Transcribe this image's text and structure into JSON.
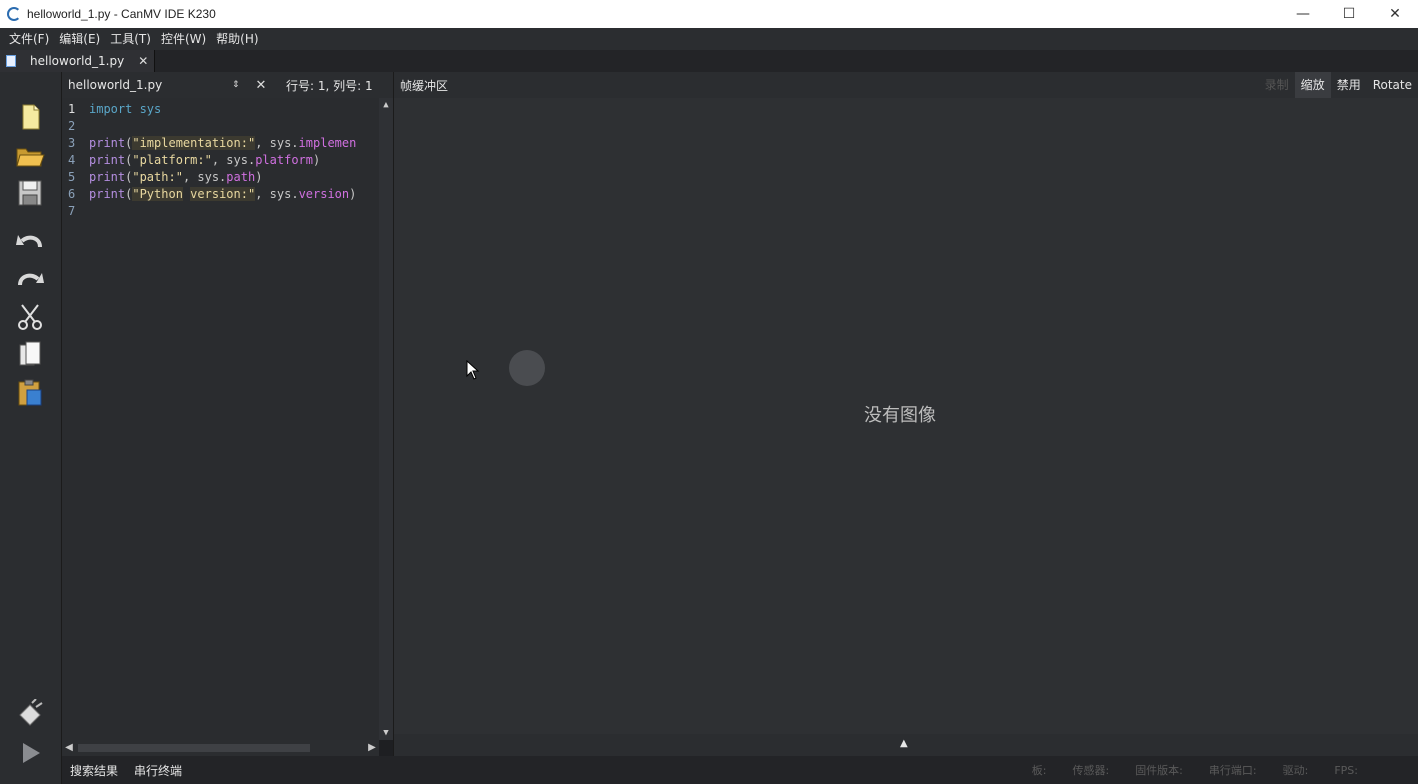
{
  "window": {
    "title": "helloworld_1.py - CanMV IDE K230",
    "minimize": "—",
    "maximize": "☐",
    "close": "✕"
  },
  "menu": {
    "items": [
      "文件(F)",
      "编辑(E)",
      "工具(T)",
      "控件(W)",
      "帮助(H)"
    ]
  },
  "tab": {
    "label": "helloworld_1.py",
    "close": "✕"
  },
  "editor": {
    "filename": "helloworld_1.py",
    "updown": "⇕",
    "close": "✕",
    "position": "行号: 1, 列号: 1",
    "line_numbers": [
      "1",
      "2",
      "3",
      "4",
      "5",
      "6",
      "7"
    ]
  },
  "code": {
    "l1_kw": "import",
    "l1_mod": " sys",
    "l3_fn": "print",
    "l3_p1": "(",
    "l3_str": "\"implementation:\"",
    "l3_p2": ", sys.",
    "l3_attr": "implemen",
    "l4_fn": "print",
    "l4_p1": "(",
    "l4_str": "\"platform:\"",
    "l4_p2": ", sys.",
    "l4_attr": "platform",
    "l4_p3": ")",
    "l5_fn": "print",
    "l5_p1": "(",
    "l5_str": "\"path:\"",
    "l5_p2": ", sys.",
    "l5_attr": "path",
    "l5_p3": ")",
    "l6_fn": "print",
    "l6_p1": "(",
    "l6_str_a": "\"Python",
    "l6_sp": " ",
    "l6_str_b": "version:\"",
    "l6_p2": ", sys.",
    "l6_attr": "version",
    "l6_p3": ")"
  },
  "framebuffer": {
    "title": "帧缓冲区",
    "record": "录制",
    "zoom": "缩放",
    "disable": "禁用",
    "rotate": "Rotate",
    "no_image": "没有图像",
    "expand": "▲"
  },
  "statusbar": {
    "search_results": "搜索结果",
    "serial_terminal": "串行终端",
    "board": "板:",
    "sensor": "传感器:",
    "firmware": "固件版本:",
    "serial_port": "串行端口:",
    "drive": "驱动:",
    "fps": "FPS:"
  },
  "colors": {
    "keyword": "#5aa6c8",
    "function": "#b48ee0",
    "string": "#e8d8a0",
    "attribute": "#d070e0",
    "background": "#2e3033"
  }
}
